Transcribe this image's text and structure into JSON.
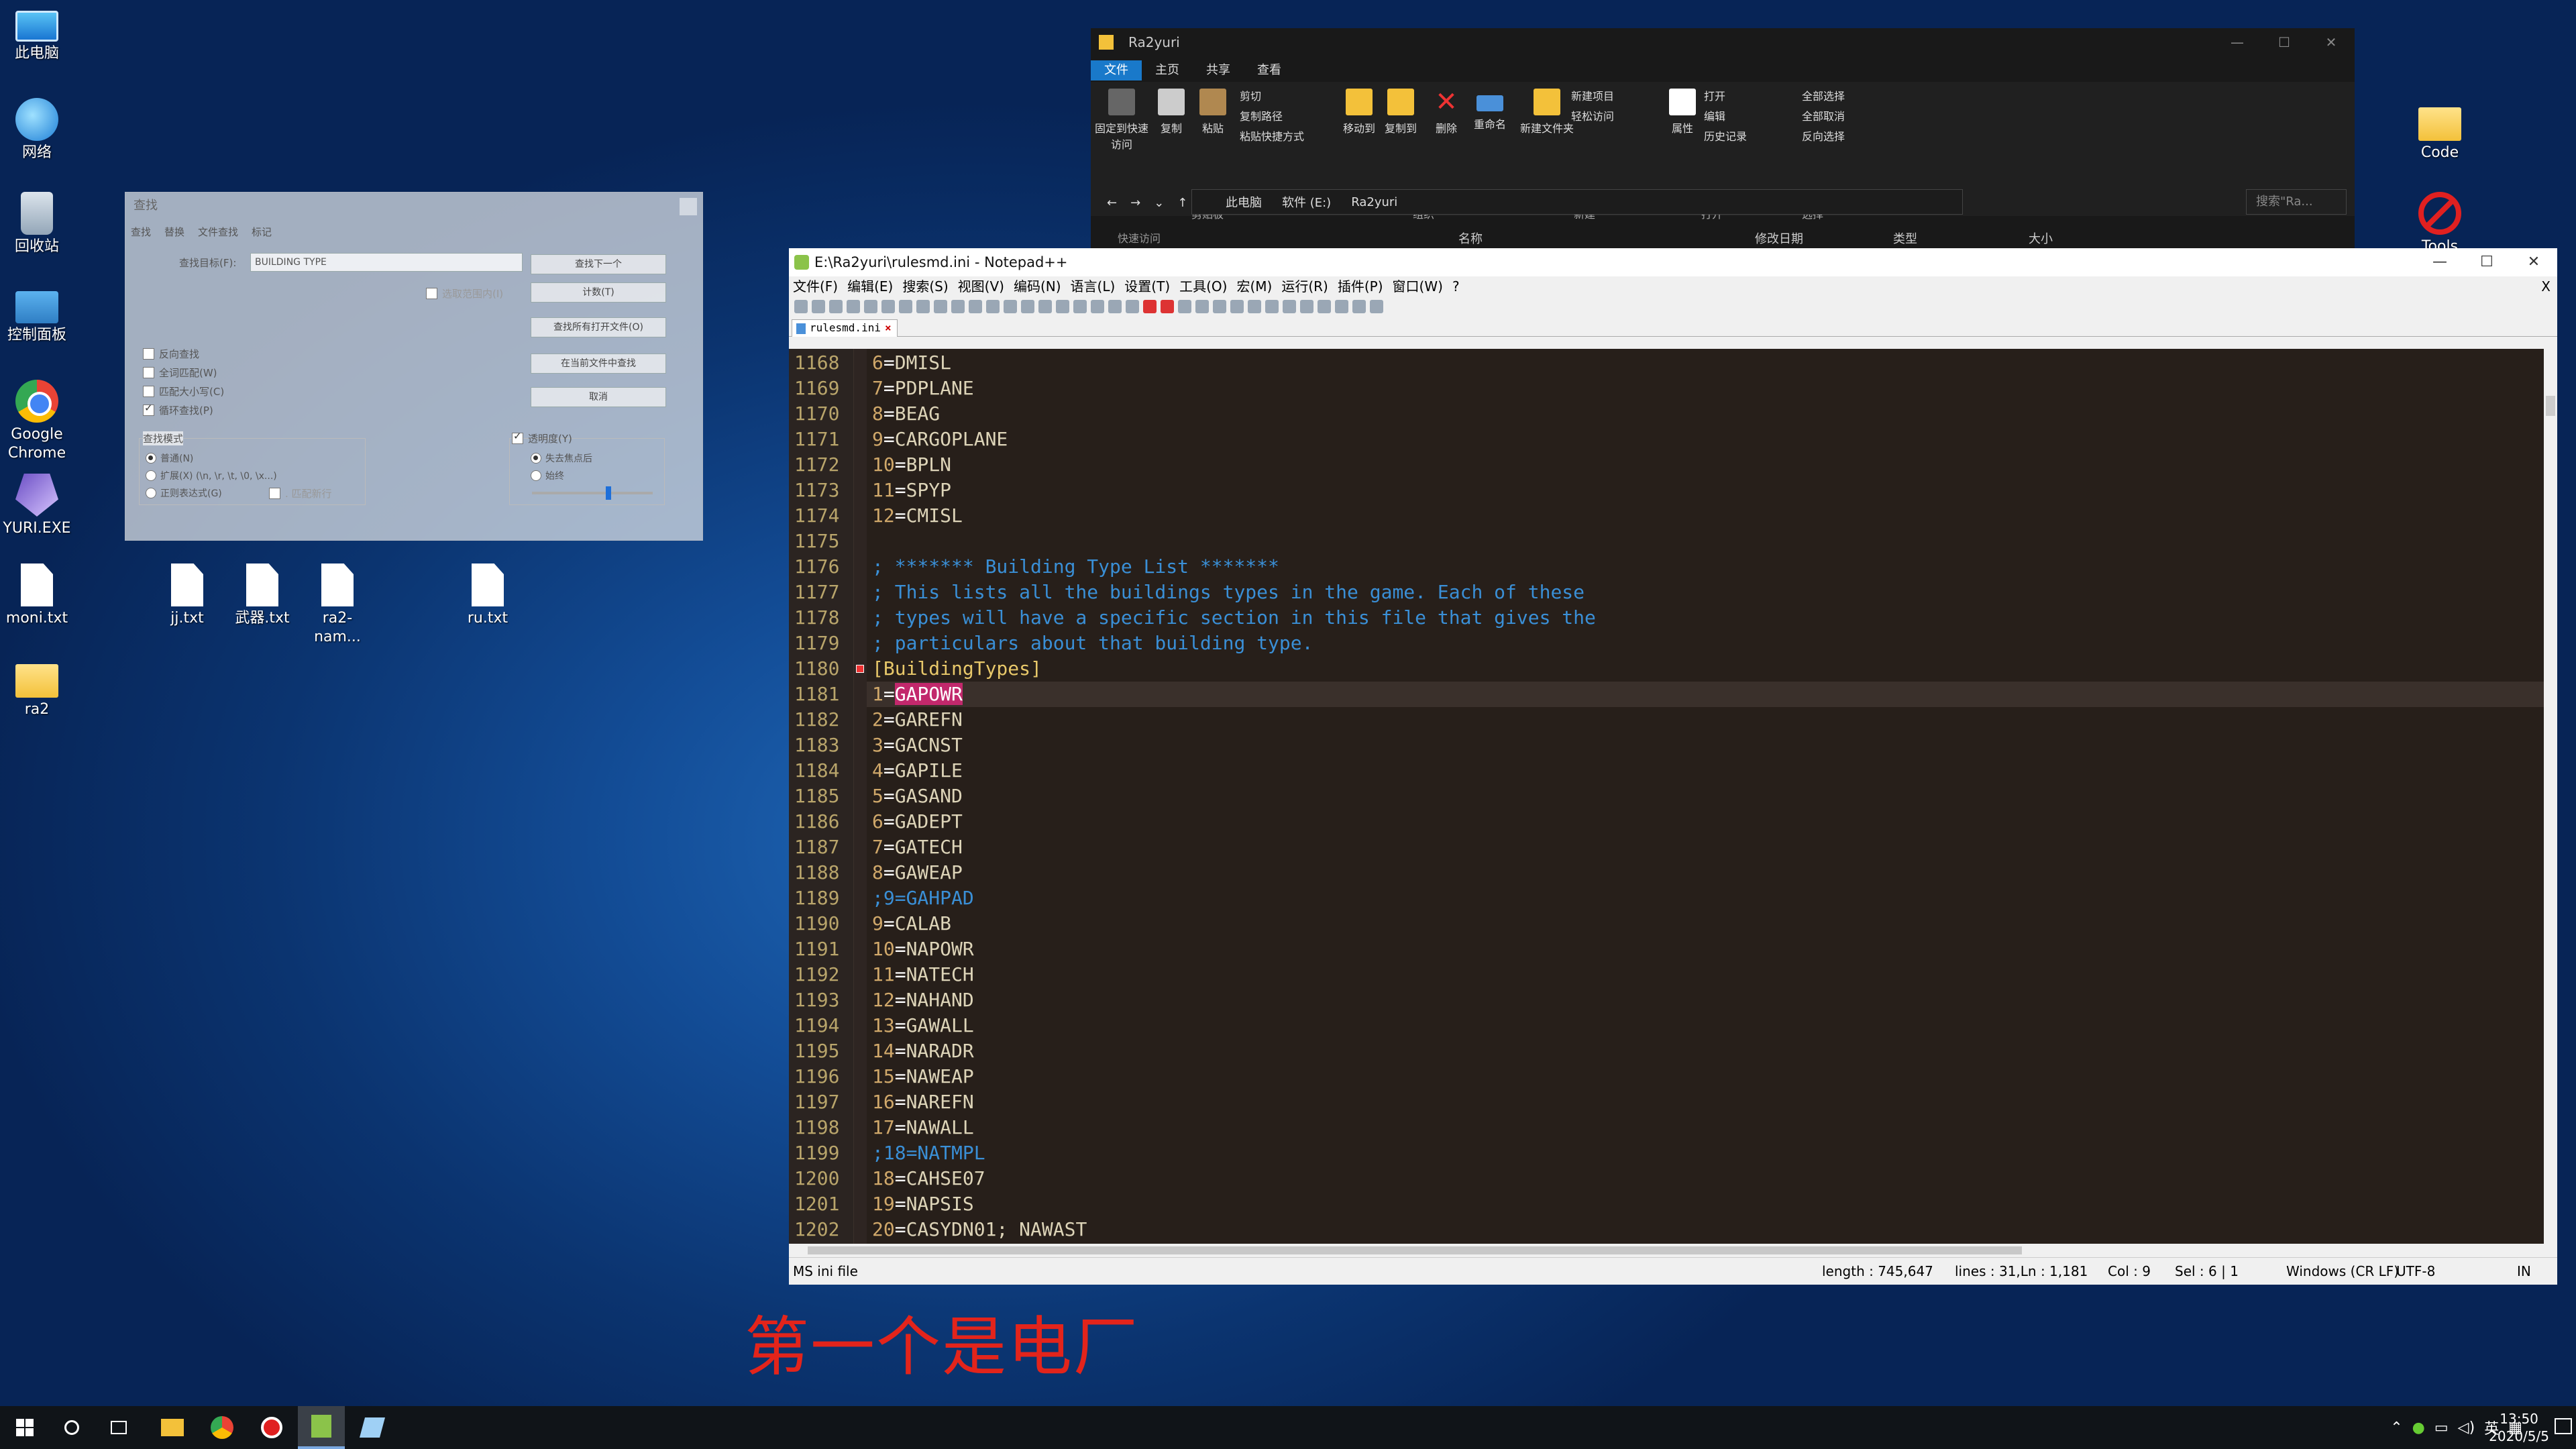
{
  "desktop": {
    "icons_left": [
      {
        "label": "此电脑",
        "icon": "computer-icon"
      },
      {
        "label": "网络",
        "icon": "network-icon"
      },
      {
        "label": "回收站",
        "icon": "recycle-bin-icon"
      },
      {
        "label": "控制面板",
        "icon": "control-panel-icon"
      },
      {
        "label": "Google Chrome",
        "icon": "chrome-icon"
      },
      {
        "label": "YURI.EXE",
        "icon": "yuri-icon"
      },
      {
        "label": "moni.txt",
        "icon": "text-file-icon"
      },
      {
        "label": "ra2",
        "icon": "folder-icon"
      }
    ],
    "icons_files": [
      {
        "label": "jj.txt"
      },
      {
        "label": "武器.txt"
      },
      {
        "label": "ra2-nam..."
      },
      {
        "label": "ru.txt"
      }
    ],
    "icons_right": [
      {
        "label": "Code",
        "icon": "folder-icon"
      },
      {
        "label": "Tools",
        "icon": "no-entry-icon"
      }
    ]
  },
  "find_dialog": {
    "title": "查找",
    "tabs": [
      "查找",
      "替换",
      "文件查找",
      "标记"
    ],
    "find_label": "查找目标(F):",
    "find_value": "BUILDING TYPE",
    "in_selection": "选取范围内(I)",
    "buttons": [
      "查找下一个",
      "计数(T)",
      "查找所有打开文件(O)",
      "在当前文件中查找",
      "取消"
    ],
    "options": [
      {
        "label": "反向查找",
        "checked": false
      },
      {
        "label": "全词匹配(W)",
        "checked": false
      },
      {
        "label": "匹配大小写(C)",
        "checked": false
      },
      {
        "label": "循环查找(P)",
        "checked": true
      }
    ],
    "mode_label": "查找模式",
    "modes": [
      {
        "label": "普通(N)",
        "checked": true
      },
      {
        "label": "扩展(X) (\\n, \\r, \\t, \\0, \\x...)",
        "checked": false
      },
      {
        "label": "正则表达式(G)",
        "checked": false
      }
    ],
    "dot_newline": ". 匹配新行",
    "transparency_label": "透明度(Y)",
    "transparency": [
      {
        "label": "失去焦点后",
        "checked": true
      },
      {
        "label": "始终",
        "checked": false
      }
    ]
  },
  "explorer": {
    "title": "Ra2yuri",
    "ribbon_tabs": [
      "文件",
      "主页",
      "共享",
      "查看"
    ],
    "clipboard": {
      "pin": "固定到快速访问",
      "copy": "复制",
      "paste": "粘贴",
      "cut": "剪切",
      "copy_path": "复制路径",
      "paste_shortcut": "粘贴快捷方式",
      "group": "剪贴板"
    },
    "organize": {
      "move": "移动到",
      "copy_to": "复制到",
      "delete": "删除",
      "rename": "重命名",
      "group": "组织"
    },
    "new": {
      "new_folder": "新建文件夹",
      "new_item": "新建项目",
      "easy_access": "轻松访问",
      "group": "新建"
    },
    "open": {
      "properties": "属性",
      "open": "打开",
      "edit": "编辑",
      "history": "历史记录",
      "group": "打开"
    },
    "select": {
      "all": "全部选择",
      "none": "全部取消",
      "invert": "反向选择",
      "group": "选择"
    },
    "breadcrumb": [
      "此电脑",
      "软件 (E:)",
      "Ra2yuri"
    ],
    "search_placeholder": "搜索\"Ra...",
    "columns": [
      "名称",
      "修改日期",
      "类型",
      "大小"
    ],
    "quick_access": "快速访问"
  },
  "notepad": {
    "title": "E:\\Ra2yuri\\rulesmd.ini - Notepad++",
    "menu": [
      "文件(F)",
      "编辑(E)",
      "搜索(S)",
      "视图(V)",
      "编码(N)",
      "语言(L)",
      "设置(T)",
      "工具(O)",
      "宏(M)",
      "运行(R)",
      "插件(P)",
      "窗口(W)",
      "?"
    ],
    "close_doc": "X",
    "tab": "rulesmd.ini",
    "lines": [
      {
        "n": "1168",
        "t": "6=DMISL"
      },
      {
        "n": "1169",
        "t": "7=PDPLANE"
      },
      {
        "n": "1170",
        "t": "8=BEAG"
      },
      {
        "n": "1171",
        "t": "9=CARGOPLANE"
      },
      {
        "n": "1172",
        "t": "10=BPLN"
      },
      {
        "n": "1173",
        "t": "11=SPYP"
      },
      {
        "n": "1174",
        "t": "12=CMISL"
      },
      {
        "n": "1175",
        "t": ""
      },
      {
        "n": "1176",
        "t": "; ******* Building Type List *******"
      },
      {
        "n": "1177",
        "t": "; This lists all the buildings types in the game. Each of these"
      },
      {
        "n": "1178",
        "t": "; types will have a specific section in this file that gives the"
      },
      {
        "n": "1179",
        "t": "; particulars about that building type."
      },
      {
        "n": "1180",
        "t": "[BuildingTypes]"
      },
      {
        "n": "1181",
        "t": "1=GAPOWR"
      },
      {
        "n": "1182",
        "t": "2=GAREFN"
      },
      {
        "n": "1183",
        "t": "3=GACNST"
      },
      {
        "n": "1184",
        "t": "4=GAPILE"
      },
      {
        "n": "1185",
        "t": "5=GASAND"
      },
      {
        "n": "1186",
        "t": "6=GADEPT"
      },
      {
        "n": "1187",
        "t": "7=GATECH"
      },
      {
        "n": "1188",
        "t": "8=GAWEAP"
      },
      {
        "n": "1189",
        "t": ";9=GAHPAD"
      },
      {
        "n": "1190",
        "t": "9=CALAB"
      },
      {
        "n": "1191",
        "t": "10=NAPOWR"
      },
      {
        "n": "1192",
        "t": "11=NATECH"
      },
      {
        "n": "1193",
        "t": "12=NAHAND"
      },
      {
        "n": "1194",
        "t": "13=GAWALL"
      },
      {
        "n": "1195",
        "t": "14=NARADR"
      },
      {
        "n": "1196",
        "t": "15=NAWEAP"
      },
      {
        "n": "1197",
        "t": "16=NAREFN"
      },
      {
        "n": "1198",
        "t": "17=NAWALL"
      },
      {
        "n": "1199",
        "t": ";18=NATMPL"
      },
      {
        "n": "1200",
        "t": "18=CAHSE07"
      },
      {
        "n": "1201",
        "t": "19=NAPSIS"
      },
      {
        "n": "1202",
        "t": "20=CASYDN01; NAWAST"
      }
    ],
    "current_line": "1181",
    "selection": "GAPOWR",
    "status": {
      "type": "MS ini file",
      "length": "length : 745,647",
      "lines": "lines : 31,Ln : 1,181",
      "col": "Col : 9",
      "sel": "Sel : 6 | 1",
      "eol": "Windows (CR LF)",
      "enc": "UTF-8",
      "ins": "IN"
    }
  },
  "caption": "第一个是电厂",
  "taskbar": {
    "tray_lang": "英",
    "time": "13:50",
    "date": "2020/5/5"
  },
  "colors": {
    "editor_bg": "#271f1a",
    "comment": "#3a8fd6",
    "section": "#e8c86a",
    "selection": "#c2286c",
    "caption": "#e3241b"
  }
}
